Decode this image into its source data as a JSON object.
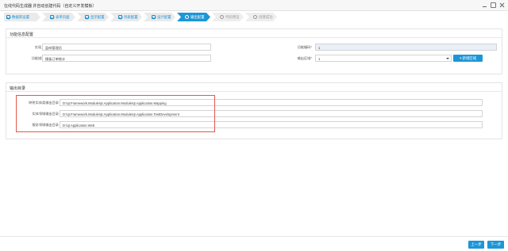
{
  "window": {
    "title": "在线代码生成器 并自动创建代码（自定义开发模板）",
    "controls": [
      "minimize-icon",
      "maximize-icon",
      "close-icon"
    ]
  },
  "steps": [
    {
      "label": "数据库设置",
      "state": "done",
      "icon": "check-icon"
    },
    {
      "label": "表单页面",
      "state": "done",
      "icon": "check-icon"
    },
    {
      "label": "显示配置",
      "state": "done",
      "icon": "check-icon"
    },
    {
      "label": "列表配置",
      "state": "done",
      "icon": "check-icon"
    },
    {
      "label": "设计配置",
      "state": "done",
      "icon": "check-icon"
    },
    {
      "label": "输出配置",
      "state": "active",
      "icon": "gear-icon"
    },
    {
      "label": "代码预览",
      "state": "future",
      "icon": "circle-icon"
    },
    {
      "label": "创建成功",
      "state": "future",
      "icon": "circle-icon"
    }
  ],
  "function_panel": {
    "header": "功能信息配置",
    "fields": {
      "class_name_label": "实现入*",
      "class_name_value": "监听管理员",
      "function_desc_label": "功能描述*",
      "function_desc_value": "模板订单统计",
      "function_code_label": "功能编码*",
      "function_code_value": "1",
      "output_area_label": "输出区域*",
      "output_area_value": "1",
      "add_area_button": "新增区域"
    }
  },
  "output_panel": {
    "header": "输出目录",
    "rows": [
      {
        "label": "映射实体类输出目录",
        "value": "D:\\qt.Framework.Module\\qt.Application.Module\\qt.Application.Mapping"
      },
      {
        "label": "实体领域输出目录",
        "value": "D:\\qt.Framework.Module\\qt.Application.Module\\qt.Application.TestDevelopment"
      },
      {
        "label": "服务领域输出目录",
        "value": "D:\\qt.Application.Web"
      }
    ]
  },
  "footer": {
    "prev_button": "上一步",
    "next_button": "下一步"
  },
  "colors": {
    "accent": "#1d96d8",
    "highlight_box": "#e05a4f"
  }
}
